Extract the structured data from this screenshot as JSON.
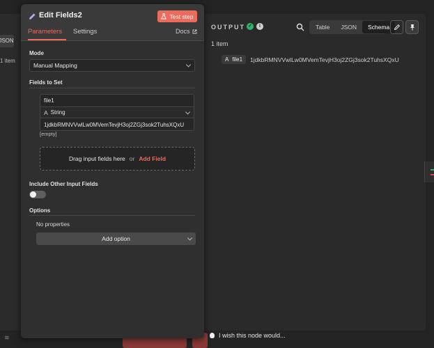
{
  "left_panel": {
    "json_label": "JSON",
    "item_count": "1 item"
  },
  "node": {
    "title": "Edit Fields2",
    "test_step_label": "Test step",
    "tabs": [
      "Parameters",
      "Settings"
    ],
    "docs_label": "Docs"
  },
  "params": {
    "mode_label": "Mode",
    "mode_value": "Manual Mapping",
    "fields_label": "Fields to Set",
    "field": {
      "name": "file1",
      "type": "String",
      "value": "1jdkbRMNVVwlLw0MVemTevjH3oj2ZGj3sok2TuhsXQxU",
      "hint": "[empty]"
    },
    "drop_text": "Drag input fields here",
    "drop_or": "or",
    "add_field": "Add Field",
    "include_label": "Include Other Input Fields",
    "include_on": false,
    "options_label": "Options",
    "no_properties": "No properties",
    "add_option": "Add option"
  },
  "output": {
    "title": "OUTPUT",
    "views": [
      "Table",
      "JSON",
      "Schema"
    ],
    "active_view": "Schema",
    "item_count": "1 item",
    "schema": {
      "type_glyph": "A",
      "key": "file1",
      "value": "1jdkbRMNVVwlLw0MVemTevjH3oj2ZGj3sok2TuhsXQxU"
    }
  },
  "footer": {
    "wish_text": "I wish this node would..."
  },
  "colors": {
    "accent": "#ec6b5c",
    "success": "#2fb36a",
    "panel": "#2f2f2f"
  }
}
